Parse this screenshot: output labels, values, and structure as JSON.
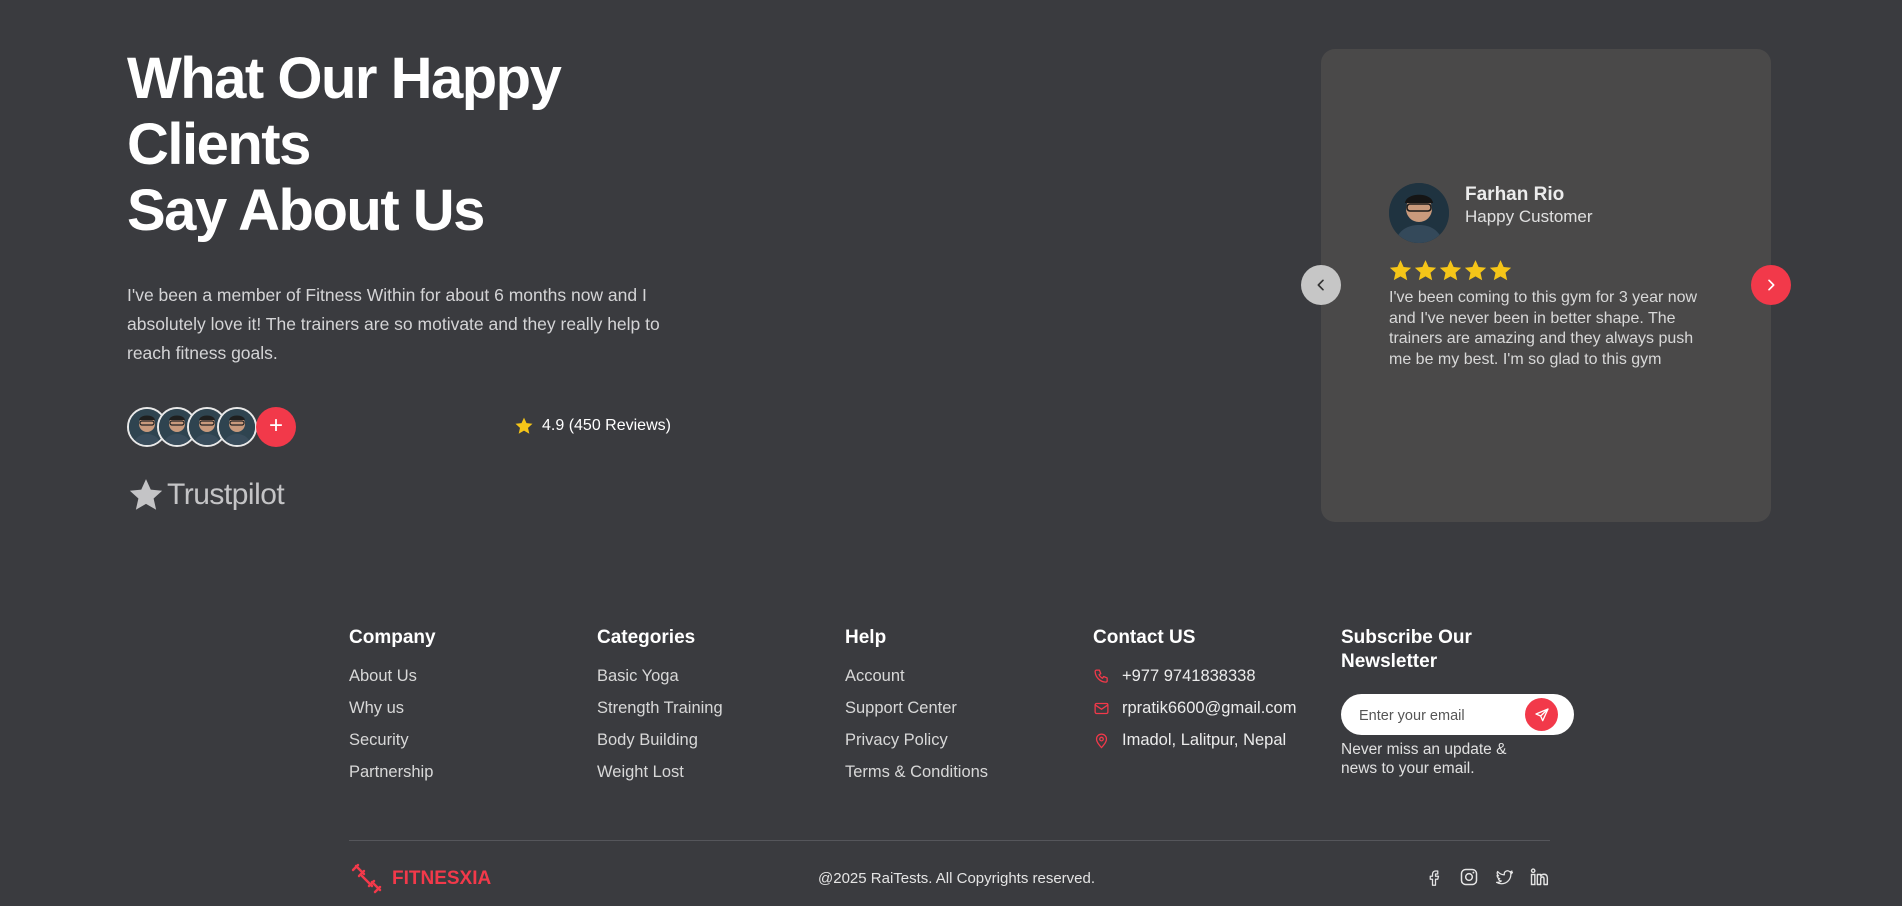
{
  "testimonials": {
    "title_lines": [
      "What Our Happy",
      "Clients",
      "Say About Us"
    ],
    "description": "I've been a member of Fitness Within for about 6 months now and I absolutely love it! The trainers are so motivate and they really help to reach fitness goals.",
    "plus_label": "+",
    "rating_text": "4.9 (450 Reviews)",
    "trustpilot_label": "Trustpilot",
    "card": {
      "name": "Farhan Rio",
      "role": "Happy Customer",
      "stars": 5,
      "review": "I've been coming to this gym for 3 year now and I've never been in better shape. The trainers are amazing and they always push me be my best. I'm so glad to this gym"
    }
  },
  "footer": {
    "company": {
      "title": "Company",
      "items": [
        "About Us",
        "Why us",
        "Security",
        "Partnership"
      ]
    },
    "categories": {
      "title": "Categories",
      "items": [
        "Basic Yoga",
        "Strength Training",
        "Body Building",
        "Weight Lost"
      ]
    },
    "help": {
      "title": "Help",
      "items": [
        "Account",
        "Support Center",
        "Privacy Policy",
        "Terms & Conditions"
      ]
    },
    "contact": {
      "title": "Contact US",
      "phone": "+977 9741838338",
      "email": "rpratik6600@gmail.com",
      "address": "Imadol, Lalitpur, Nepal"
    },
    "newsletter": {
      "title": "Subscribe Our Newsletter",
      "placeholder": "Enter your email",
      "note": "Never miss an update & news to your email."
    },
    "brand": "FITNESXIA",
    "copyright": "@2025 RaiTests. All Copyrights reserved."
  },
  "colors": {
    "background": "#3a3b3f",
    "accent": "#f2394a",
    "card": "#4a4949",
    "star": "#f5c518"
  },
  "icons": {
    "social": [
      "facebook-icon",
      "instagram-icon",
      "twitter-icon",
      "linkedin-icon"
    ],
    "contact": [
      "phone-icon",
      "mail-icon",
      "location-pin-icon"
    ]
  }
}
